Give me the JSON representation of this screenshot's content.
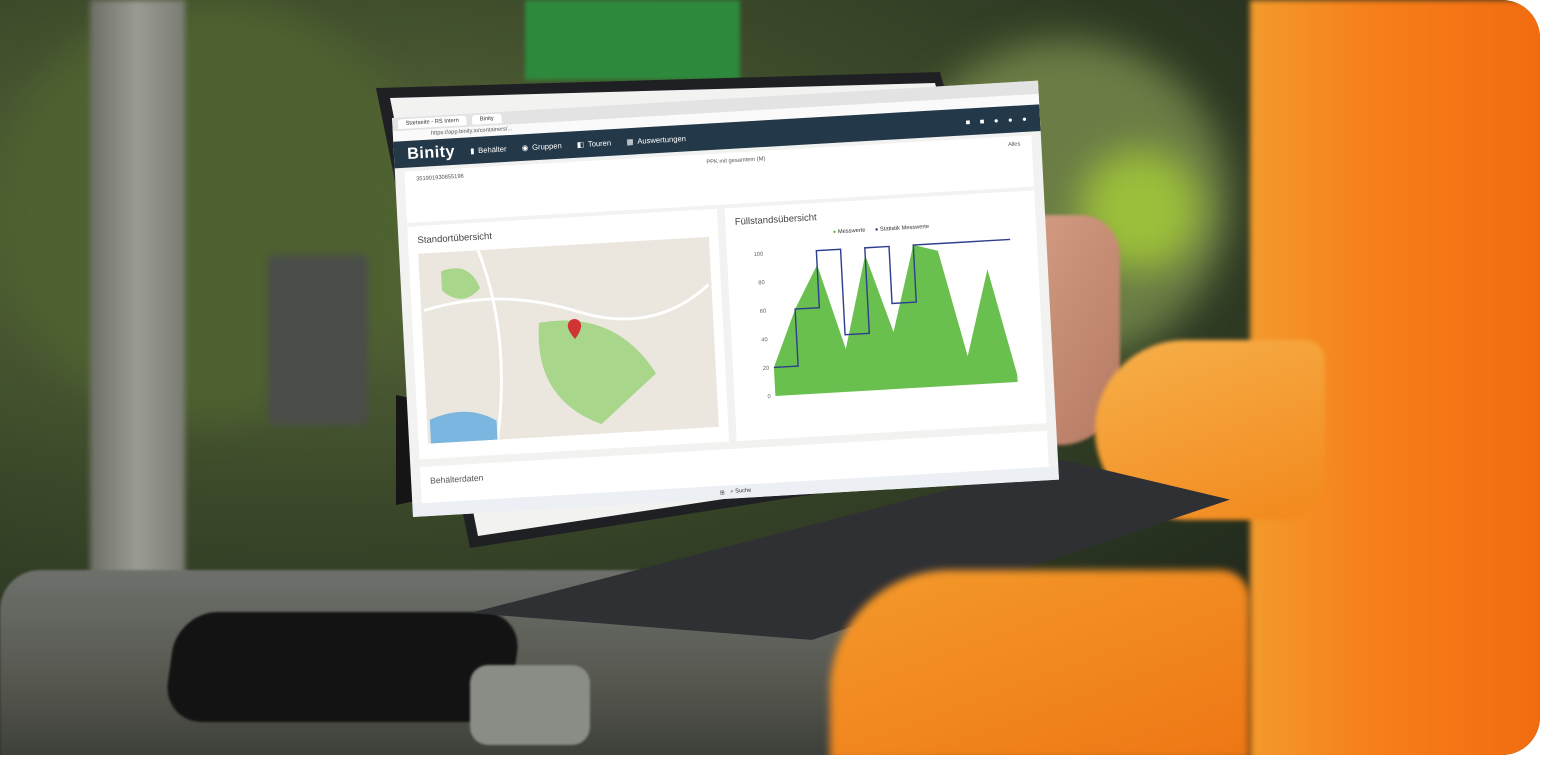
{
  "browser": {
    "tabs": [
      {
        "label": "Startseite - RS Intern"
      },
      {
        "label": "Binity"
      }
    ],
    "url": "https://app.binity.io/containers/..."
  },
  "app": {
    "brand": "Binity",
    "nav": [
      {
        "label": "Behälter",
        "icon": "bin-icon"
      },
      {
        "label": "Gruppen",
        "icon": "group-icon"
      },
      {
        "label": "Touren",
        "icon": "route-icon"
      },
      {
        "label": "Auswertungen",
        "icon": "chart-icon"
      }
    ]
  },
  "info": {
    "id": "351901930855196",
    "material": "PPK mit gesamtem (M)",
    "schedule": "Alles"
  },
  "cards": {
    "location_title": "Standortübersicht",
    "fill_title": "Füllstandsübersicht",
    "legend": [
      "Messwerte",
      "Statistik Messwerte"
    ],
    "container_title": "Behälterdaten"
  },
  "taskbar": {
    "search": "Suche"
  },
  "chart_data": {
    "type": "area",
    "title": "Füllstandsübersicht",
    "ylim": [
      0,
      100
    ],
    "yticks": [
      0,
      20,
      40,
      60,
      80,
      100
    ],
    "series": [
      {
        "name": "Messwerte",
        "values": [
          20,
          60,
          90,
          30,
          95,
          40,
          100,
          95,
          20,
          80,
          5
        ]
      },
      {
        "name": "Statistik Messwerte",
        "values": [
          20,
          60,
          100,
          40,
          100,
          60,
          100,
          100,
          100,
          100,
          100
        ]
      }
    ]
  },
  "colors": {
    "nav_bg": "#23394a",
    "chart_fill": "#6ac04e",
    "chart_line": "#2e3f8f",
    "jacket": "#f4871c",
    "pin": "#d13434"
  }
}
